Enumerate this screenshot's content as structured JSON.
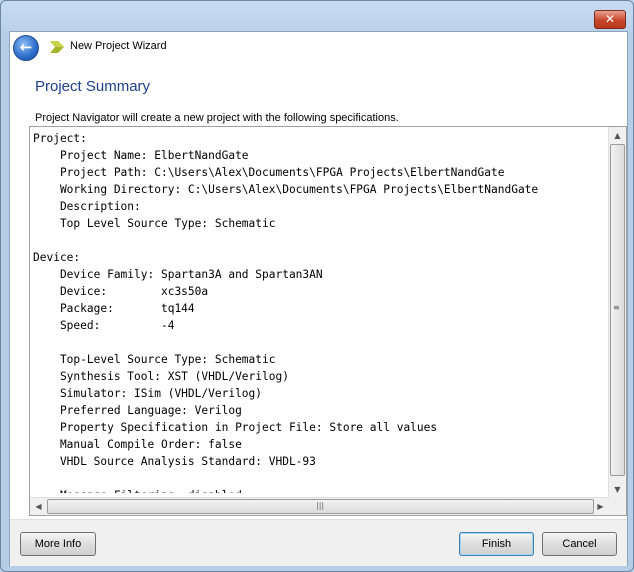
{
  "window": {
    "close_glyph": "✕"
  },
  "header": {
    "back_glyph": "←",
    "icon": "wizard-arrow-icon",
    "title": "New Project Wizard"
  },
  "page": {
    "title": "Project Summary",
    "intro": "Project Navigator will create a new project with the following specifications."
  },
  "summary": {
    "lines": [
      "Project:",
      "    Project Name: ElbertNandGate",
      "    Project Path: C:\\Users\\Alex\\Documents\\FPGA Projects\\ElbertNandGate",
      "    Working Directory: C:\\Users\\Alex\\Documents\\FPGA Projects\\ElbertNandGate",
      "    Description:",
      "    Top Level Source Type: Schematic",
      "",
      "Device:",
      "    Device Family: Spartan3A and Spartan3AN",
      "    Device:        xc3s50a",
      "    Package:       tq144",
      "    Speed:         -4",
      "",
      "    Top-Level Source Type: Schematic",
      "    Synthesis Tool: XST (VHDL/Verilog)",
      "    Simulator: ISim (VHDL/Verilog)",
      "    Preferred Language: Verilog",
      "    Property Specification in Project File: Store all values",
      "    Manual Compile Order: false",
      "    VHDL Source Analysis Standard: VHDL-93",
      "",
      "    Message Filtering: disabled"
    ]
  },
  "buttons": {
    "more_info": "More Info",
    "finish": "Finish",
    "cancel": "Cancel"
  }
}
